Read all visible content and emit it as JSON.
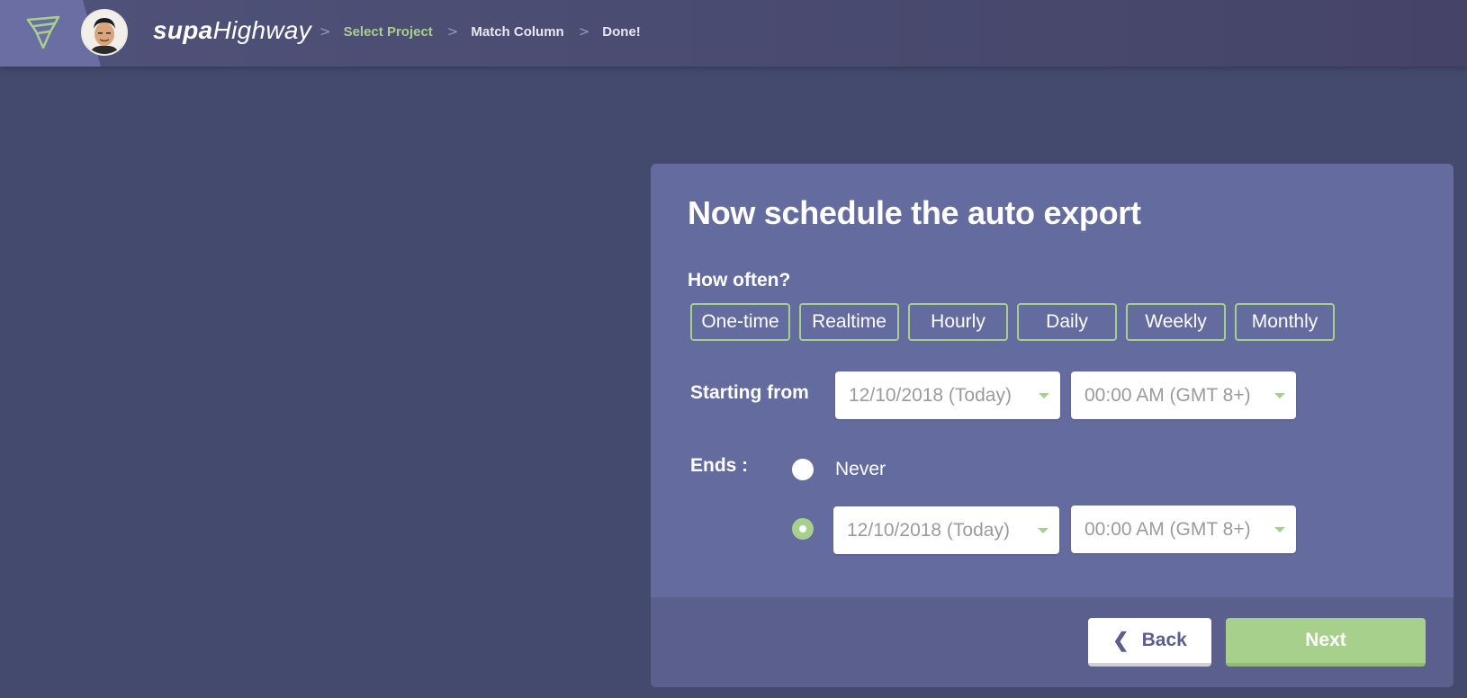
{
  "header": {
    "brand_bold": "supa",
    "brand_rest": "Highway",
    "breadcrumbs": [
      {
        "label": "Select Project",
        "active": true
      },
      {
        "label": "Match Column",
        "active": false
      },
      {
        "label": "Done!",
        "active": false
      }
    ],
    "separator": ">"
  },
  "colors": {
    "accent": "#a8d08d",
    "card": "#646b9e",
    "background": "#434a6e"
  },
  "form": {
    "title": "Now schedule the auto export",
    "how_often_label": "How often?",
    "frequencies": [
      "One-time",
      "Realtime",
      "Hourly",
      "Daily",
      "Weekly",
      "Monthly"
    ],
    "starting_label": "Starting from",
    "start_date": "12/10/2018 (Today)",
    "start_time": "00:00 AM (GMT 8+)",
    "ends_label": "Ends :",
    "ends_never_label": "Never",
    "ends_option_selected": "date",
    "end_date": "12/10/2018 (Today)",
    "end_time": "00:00 AM (GMT 8+)"
  },
  "footer": {
    "back_label": "Back",
    "next_label": "Next"
  }
}
